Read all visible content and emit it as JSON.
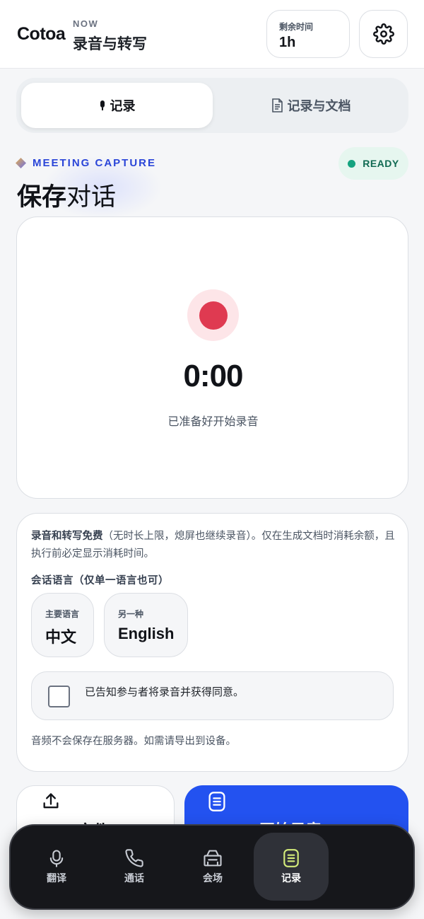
{
  "header": {
    "logo": "Cotoa",
    "now_label": "NOW",
    "title": "录音与转写",
    "time_label": "剩余时间",
    "time_value": "1h",
    "settings_icon": "gear-icon"
  },
  "tabs": [
    {
      "label": "记录",
      "icon": "mic-icon",
      "active": true
    },
    {
      "label": "记录与文档",
      "icon": "document-icon",
      "active": false
    }
  ],
  "section": {
    "eyebrow": "MEETING CAPTURE",
    "status": "READY",
    "status_color": "#14a37f",
    "title_bold": "保存",
    "title_light": "对话"
  },
  "recorder": {
    "timer": "0:00",
    "status_text": "已准备好开始录音",
    "record_color": "#df3a51"
  },
  "info": {
    "highlight": "录音和转写免费",
    "text": "（无时长上限，熄屏也继续录音）。仅在生成文档时消耗余额，且执行前必定显示消耗时间。",
    "language_heading": "会话语言（仅单一语言也可）",
    "primary_label": "主要语言",
    "primary_value": "中文",
    "secondary_label": "另一种",
    "secondary_value": "English",
    "consent_text": "已告知参与者将录音并获得同意。",
    "consent_checked": false,
    "note": "音频不会保存在服务器。如需请导出到设备。"
  },
  "actions": {
    "export_label": "文件",
    "start_label": "开始录音",
    "accent_color": "#2352f0"
  },
  "nav": [
    {
      "label": "翻译",
      "icon": "microphone-icon",
      "active": false
    },
    {
      "label": "通话",
      "icon": "phone-icon",
      "active": false
    },
    {
      "label": "会场",
      "icon": "venue-icon",
      "active": false
    },
    {
      "label": "记录",
      "icon": "notes-icon",
      "active": true
    }
  ]
}
